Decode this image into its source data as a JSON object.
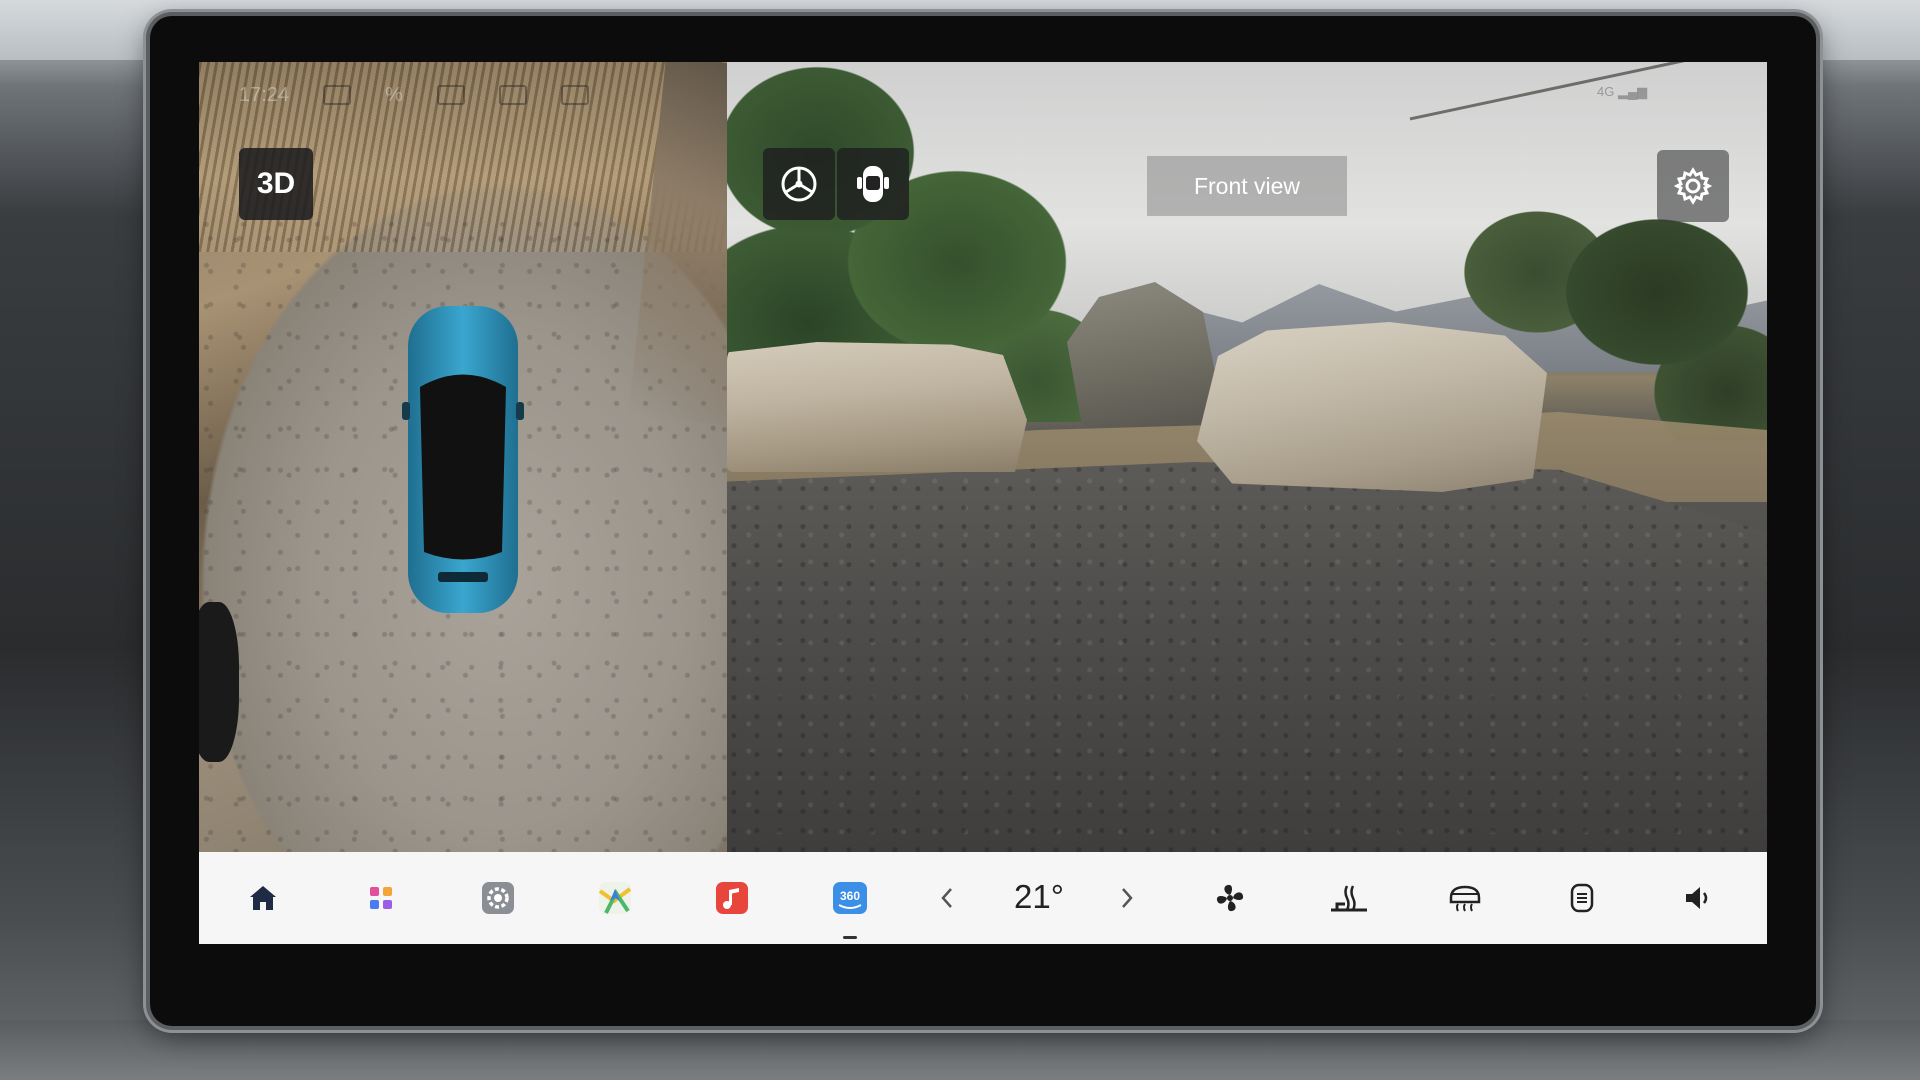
{
  "camera": {
    "mode_button": "3D",
    "view_label": "Front view",
    "left_buttons": [
      "wheel-icon",
      "car-doors-icon"
    ],
    "settings": "gear-icon"
  },
  "status_bar": {
    "time": "17:24",
    "battery": "%"
  },
  "dock": {
    "temperature": "21°",
    "items": [
      "home-icon",
      "apps-grid-icon",
      "settings-icon",
      "maps-icon",
      "music-icon",
      "camera-360-icon",
      "fan-icon",
      "seat-heat-icon",
      "rear-defrost-icon",
      "front-defrost-icon",
      "volume-icon"
    ],
    "active_item": "camera-360-icon",
    "camera_360_label": "360"
  },
  "colors": {
    "dock_background": "#f6f6f6",
    "car_body": "#3aa6cf",
    "music_accent": "#e8453c",
    "camera_360_accent": "#3b8fe6",
    "home_icon": "#1f2a44"
  }
}
